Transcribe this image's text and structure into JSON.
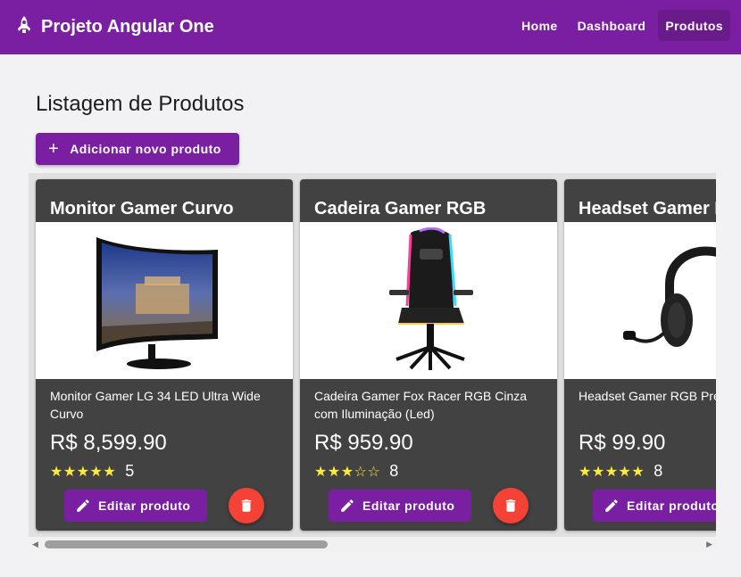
{
  "app": {
    "title": "Projeto Angular One",
    "logo_icon": "rocket-icon"
  },
  "nav": [
    {
      "label": "Home",
      "active": false
    },
    {
      "label": "Dashboard",
      "active": false
    },
    {
      "label": "Produtos",
      "active": true
    }
  ],
  "page": {
    "title": "Listagem de Produtos",
    "add_button_label": "Adicionar novo produto"
  },
  "products": [
    {
      "name": "Monitor Gamer Curvo",
      "description": "Monitor Gamer LG 34 LED Ultra Wide Curvo",
      "price": "R$ 8,599.90",
      "stars": "★★★★★",
      "rating": 5,
      "rating_count": "5",
      "edit_label": "Editar produto"
    },
    {
      "name": "Cadeira Gamer RGB",
      "description": "Cadeira Gamer Fox Racer RGB Cinza com Iluminação (Led)",
      "price": "R$ 959.90",
      "stars": "★★★☆☆",
      "rating": 3,
      "rating_count": "8",
      "edit_label": "Editar produto"
    },
    {
      "name": "Headset Gamer R",
      "description": "Headset Gamer RGB Pre",
      "price": "R$ 99.90",
      "stars": "★★★★★",
      "rating": 5,
      "rating_count": "8",
      "edit_label": "Editar produto"
    }
  ],
  "colors": {
    "primary": "#7b1fa2",
    "card_bg": "#424242",
    "delete": "#f44336",
    "star": "#ffeb3b"
  }
}
